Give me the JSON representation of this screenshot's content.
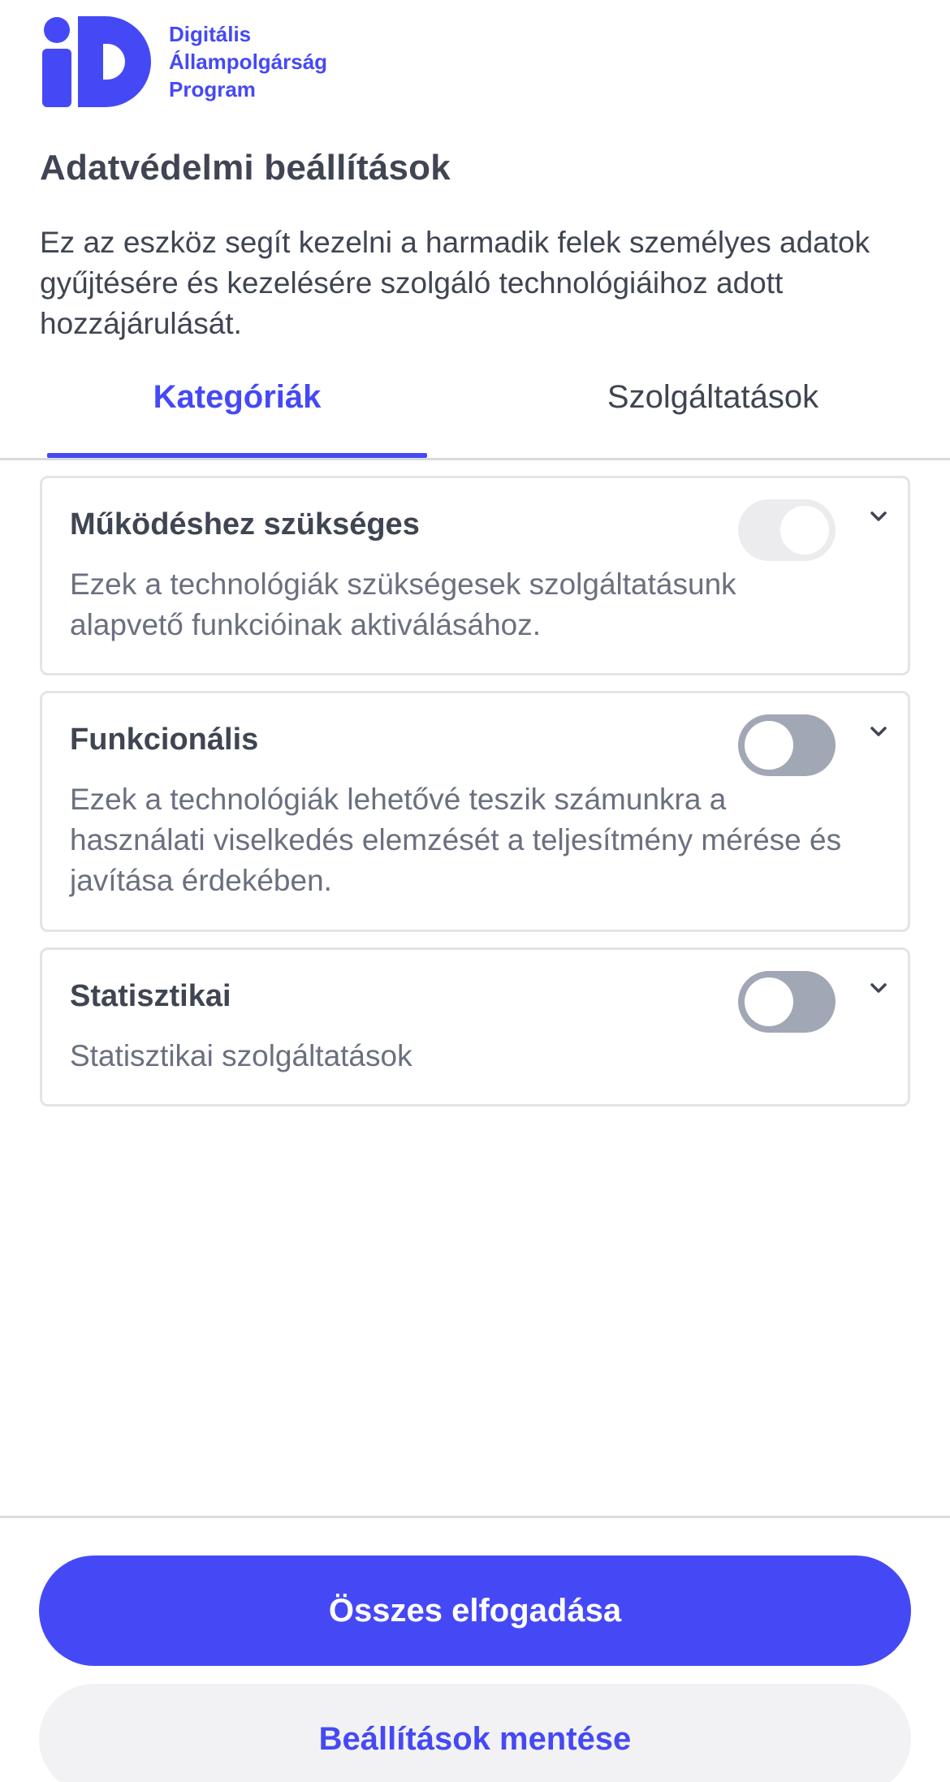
{
  "header": {
    "logo_lines": [
      "Digitális",
      "Állampolgárság",
      "Program"
    ]
  },
  "colors": {
    "accent": "#4549f5",
    "text": "#3f4552",
    "muted_text": "#6b7080",
    "toggle_off": "#a1a7b5",
    "toggle_disabled": "#ececee"
  },
  "page": {
    "title": "Adatvédelmi beállítások",
    "intro": "Ez az eszköz segít kezelni a harmadik felek személyes adatok gyűjtésére és kezelésére szolgáló technológiáihoz adott hozzájárulását."
  },
  "tabs": [
    {
      "label": "Kategóriák",
      "active": true
    },
    {
      "label": "Szolgáltatások",
      "active": false
    }
  ],
  "categories": [
    {
      "title": "Működéshez szükséges",
      "description": "Ezek a technológiák szükségesek szolgáltatásunk alapvető funkcióinak aktiválásához.",
      "toggle_state": "on-disabled",
      "icon": "chevron-down-icon"
    },
    {
      "title": "Funkcionális",
      "description": "Ezek a technológiák lehetővé teszik számunkra a használati viselkedés elemzését a teljesítmény mérése és javítása érdekében.",
      "toggle_state": "off",
      "icon": "chevron-down-icon"
    },
    {
      "title": "Statisztikai",
      "description": "Statisztikai szolgáltatások",
      "toggle_state": "off",
      "icon": "chevron-down-icon"
    }
  ],
  "buttons": {
    "accept_all": "Összes elfogadása",
    "save_settings": "Beállítások mentése"
  }
}
